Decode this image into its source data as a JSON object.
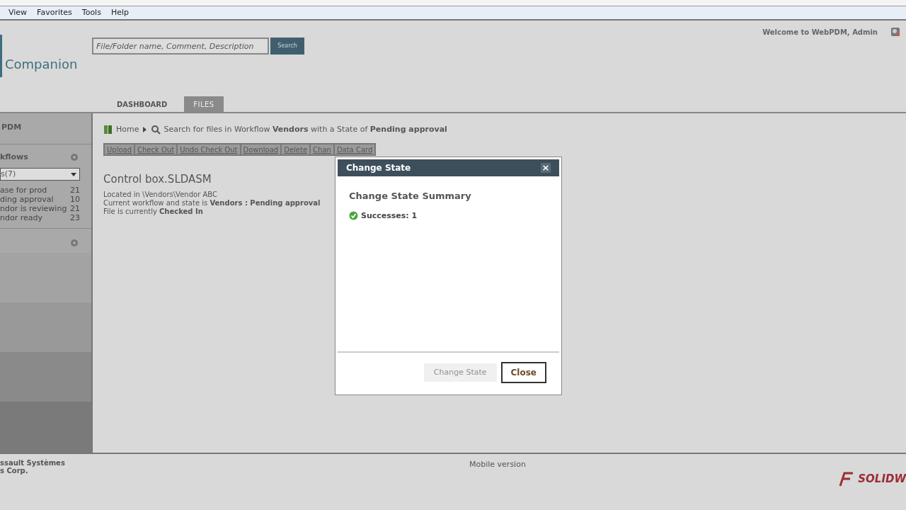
{
  "menu_bar": [
    "View",
    "Favorites",
    "Tools",
    "Help"
  ],
  "header": {
    "logo": "Companion",
    "search": {
      "placeholder": "File/Folder name, Comment, Description",
      "button": "Search"
    },
    "welcome": "Welcome to WebPDM, Admin"
  },
  "tabs": [
    {
      "label": "DASHBOARD",
      "selected": false
    },
    {
      "label": "FILES",
      "selected": true
    }
  ],
  "sidebar": {
    "title": "PDM",
    "workflows": {
      "title": "kflows",
      "dropdown": "s(7)",
      "items": [
        {
          "label": "ase for prod",
          "count": "21"
        },
        {
          "label": "ding approval",
          "count": "10"
        },
        {
          "label": "ndor is reviewing",
          "count": "21"
        },
        {
          "label": "ndor ready",
          "count": "23"
        }
      ]
    }
  },
  "breadcrumb": {
    "home": "Home",
    "search": "Search for files in Workflow **Vendors** with a State of **Pending approval**"
  },
  "toolbar": [
    {
      "label": "Upload"
    },
    {
      "label": "Check Out"
    },
    {
      "label": "Undo Check Out"
    },
    {
      "label": "Download"
    },
    {
      "label": "Delete"
    },
    {
      "label": "Chan"
    },
    {
      "label": "Data Card"
    }
  ],
  "file": {
    "name": "Control box.SLDASM",
    "lines": [
      "Located in \\Vendors\\Vendor ABC",
      "Current workflow and state is **Vendors : Pending approval**",
      "File is currently **Checked In**"
    ]
  },
  "dialog": {
    "title": "Change State",
    "close": "×",
    "heading": "Change State Summary",
    "result": "Successes: 1",
    "buttons": [
      {
        "label": "Change State",
        "disabled": true
      },
      {
        "label": "Close",
        "disabled": false
      }
    ]
  },
  "footer": {
    "copyright": [
      "ssault Systèmes",
      "s Corp."
    ],
    "mobile": "Mobile version",
    "logo": "SOLIDW"
  }
}
